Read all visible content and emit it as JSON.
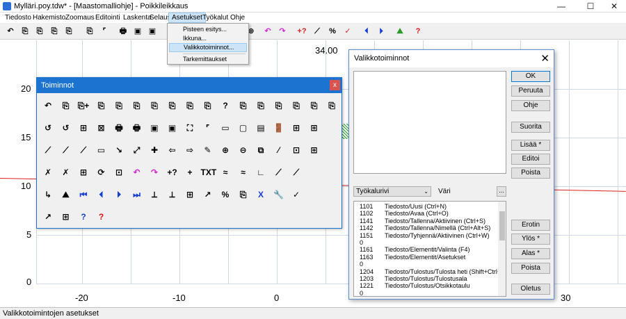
{
  "window": {
    "title": "Mylläri.poy.tdw* - [Maastomalliohje] - Poikkileikkaus"
  },
  "menubar": {
    "items": [
      "Tiedosto",
      "Hakemisto",
      "Zoomaus",
      "Editointi",
      "Laskenta",
      "Selaus",
      "Asetukset",
      "Työkalut",
      "Ohje"
    ],
    "active": "Asetukset"
  },
  "dropdown": {
    "items": [
      "Pisteen esitys...",
      "Ikkuna...",
      "Valikkotoiminnot...",
      "Tarkemittaukset"
    ],
    "highlighted": "Valikkotoiminnot..."
  },
  "plot": {
    "top_label": "34.00",
    "y_ticks": [
      "20",
      "15",
      "10",
      "5",
      "0"
    ],
    "x_ticks": [
      "-20",
      "-10",
      "0",
      "30"
    ],
    "line_color": "#e02020",
    "hatch_color": "#2aa52a"
  },
  "toiminnot": {
    "title": "Toiminnot",
    "close": "x",
    "rows": [
      [
        "↶",
        "⎘",
        "⎘+",
        "⎘",
        "⎘",
        "⎘",
        "⎘",
        "⎘",
        "⎘",
        "⎘",
        "?",
        "⎘",
        "⎘",
        "⎘",
        "⎘",
        "⎘",
        "⎘"
      ],
      [
        "↺",
        "↺",
        "⊞",
        "⊠",
        "🖶",
        "🖶",
        "▣",
        "▣",
        "⛶",
        "⌜",
        "▭",
        "▢",
        "▤",
        "🚪",
        "⊞",
        "⊞",
        ""
      ],
      [
        "⟋",
        "⟋",
        "⟋",
        "▭",
        "↘",
        "⤢",
        "✚",
        "⇦",
        "⇨",
        "✎",
        "⊕",
        "⊖",
        "⧉",
        "⁄",
        "⊡",
        "⊞",
        ""
      ],
      [
        "✗",
        "✗",
        "⊞",
        "⟳",
        "⊡",
        "↶",
        "↷",
        "+?",
        "+",
        "TXT",
        "≈",
        "≈",
        "∟",
        "⟋",
        "⟋",
        "",
        ""
      ],
      [
        "↳",
        "⛰",
        "⏮",
        "⏴",
        "⏵",
        "⏭",
        "⟂",
        "⟂",
        "⊞",
        "↗",
        "%",
        "⎘",
        "X",
        "🔧",
        "✓",
        "",
        ""
      ],
      [
        "↗",
        "⊞",
        "?",
        "?",
        "",
        "",
        "",
        "",
        "",
        "",
        "",
        "",
        "",
        "",
        "",
        "",
        ""
      ]
    ]
  },
  "valikkotoiminnot": {
    "title": "Valikkotoiminnot",
    "close": "✕",
    "dropdown_value": "Työkalurivi",
    "color_label": "Väri",
    "color_button": "...",
    "buttons_top": [
      "OK",
      "Peruuta",
      "Ohje"
    ],
    "buttons_mid": [
      "Suorita",
      "Lisää *",
      "Editoi",
      "Poista"
    ],
    "buttons_bottom": [
      "Erotin",
      "Ylös *",
      "Alas *",
      "Poista"
    ],
    "button_last": "Oletus",
    "list": [
      {
        "code": "1101",
        "text": "Tiedosto/Uusi (Ctrl+N)"
      },
      {
        "code": "1102",
        "text": "Tiedosto/Avaa (Ctrl+O)"
      },
      {
        "code": "1141",
        "text": "Tiedosto/Tallenna/Aktiivinen (Ctrl+S)"
      },
      {
        "code": "1142",
        "text": "Tiedosto/Tallenna/Nimellä (Ctrl+Alt+S)"
      },
      {
        "code": "1151",
        "text": "Tiedosto/Tyhjennä/Aktiivinen (Ctrl+W)"
      },
      {
        "code": "0",
        "text": ""
      },
      {
        "code": "1161",
        "text": "Tiedosto/Elementit/Valinta (F4)"
      },
      {
        "code": "1163",
        "text": "Tiedosto/Elementit/Asetukset"
      },
      {
        "code": "0",
        "text": ""
      },
      {
        "code": "1204",
        "text": "Tiedosto/Tulostus/Tulosta heti (Shift+Ctrl+"
      },
      {
        "code": "1203",
        "text": "Tiedosto/Tulostus/Tulostusala"
      },
      {
        "code": "1221",
        "text": "Tiedosto/Tulostus/Otsikkotaulu"
      },
      {
        "code": "0",
        "text": ""
      }
    ]
  },
  "statusbar": {
    "text": "Valikkotoimintojen asetukset"
  }
}
